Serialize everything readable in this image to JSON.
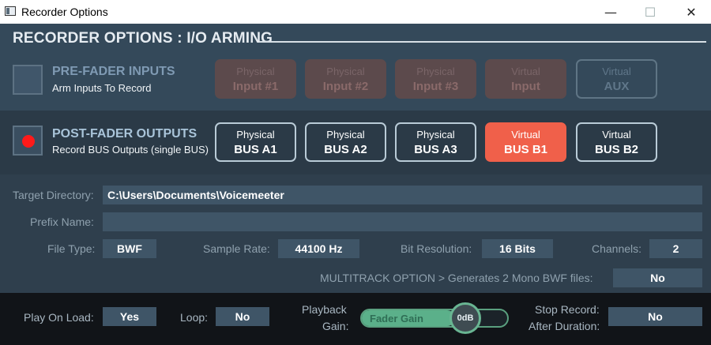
{
  "window": {
    "title": "Recorder Options",
    "minimize_glyph": "—",
    "maximize_glyph": "☐",
    "close_glyph": "✕"
  },
  "header": {
    "title": "RECORDER OPTIONS : I/O ARMING"
  },
  "pre_fader": {
    "title": "PRE-FADER INPUTS",
    "subtitle": "Arm Inputs To Record",
    "armed": false,
    "buttons": [
      {
        "type": "Physical",
        "name": "Input #1"
      },
      {
        "type": "Physical",
        "name": "Input #2"
      },
      {
        "type": "Physical",
        "name": "Input #3"
      },
      {
        "type": "Virtual",
        "name": "Input"
      },
      {
        "type": "Virtual",
        "name": "AUX"
      }
    ]
  },
  "post_fader": {
    "title": "POST-FADER OUTPUTS",
    "subtitle": "Record BUS Outputs (single BUS)",
    "armed": true,
    "buttons": [
      {
        "type": "Physical",
        "name": "BUS A1"
      },
      {
        "type": "Physical",
        "name": "BUS A2"
      },
      {
        "type": "Physical",
        "name": "BUS A3"
      },
      {
        "type": "Virtual",
        "name": "BUS B1"
      },
      {
        "type": "Virtual",
        "name": "BUS B2"
      }
    ],
    "selected": "BUS B1"
  },
  "form": {
    "target_dir_label": "Target Directory:",
    "target_dir_value": "C:\\Users\\Documents\\Voicemeeter",
    "prefix_label": "Prefix Name:",
    "prefix_value": "",
    "file_type_label": "File Type:",
    "file_type_value": "BWF",
    "sample_rate_label": "Sample Rate:",
    "sample_rate_value": "44100 Hz",
    "bit_res_label": "Bit Resolution:",
    "bit_res_value": "16 Bits",
    "channels_label": "Channels:",
    "channels_value": "2",
    "multitrack_label": "MULTITRACK OPTION > Generates 2 Mono BWF files:",
    "multitrack_value": "No"
  },
  "bottom": {
    "play_on_load_label": "Play On Load:",
    "play_on_load_value": "Yes",
    "loop_label": "Loop:",
    "loop_value": "No",
    "playback_gain_label_1": "Playback",
    "playback_gain_label_2": "Gain:",
    "fader_label": "Fader Gain",
    "fader_value": "0dB",
    "stop_record_label_1": "Stop Record:",
    "stop_record_label_2": "After Duration:",
    "stop_record_value": "No"
  },
  "colors": {
    "active_bus": "#f0604a",
    "arm_dot": "#ff1a1a",
    "fader": "#5bb08a"
  }
}
